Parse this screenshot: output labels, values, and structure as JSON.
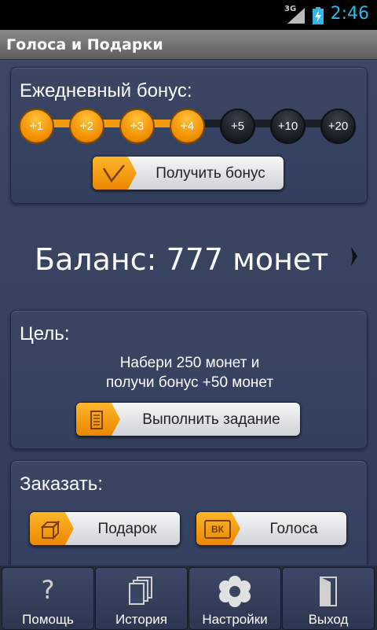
{
  "status": {
    "network": "3G",
    "time": "2:46"
  },
  "app": {
    "title": "Голоса и Подарки"
  },
  "bonus": {
    "heading": "Ежедневный бонус:",
    "steps": [
      {
        "label": "+1",
        "active": true
      },
      {
        "label": "+2",
        "active": true
      },
      {
        "label": "+3",
        "active": true
      },
      {
        "label": "+4",
        "active": true
      },
      {
        "label": "+5",
        "active": false
      },
      {
        "label": "+10",
        "active": false
      },
      {
        "label": "+20",
        "active": false
      }
    ],
    "button_label": "Получить бонус"
  },
  "balance": {
    "text": "Баланс: 777 монет"
  },
  "goal": {
    "heading": "Цель:",
    "line1": "Набери 250 монет и",
    "line2": "получи бонус +50 монет",
    "button_label": "Выполнить задание"
  },
  "order": {
    "heading": "Заказать:",
    "gift_label": "Подарок",
    "votes_label": "Голоса",
    "votes_icon_text": "ВК"
  },
  "tabs": [
    {
      "label": "Помощь",
      "icon": "help-icon"
    },
    {
      "label": "История",
      "icon": "history-icon"
    },
    {
      "label": "Настройки",
      "icon": "settings-icon"
    },
    {
      "label": "Выход",
      "icon": "exit-icon"
    }
  ],
  "colors": {
    "accent": "#f59a0c",
    "clock": "#33b5e5",
    "background": "#3a4564"
  }
}
